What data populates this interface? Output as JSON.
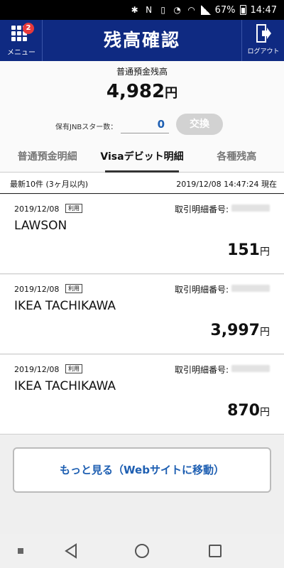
{
  "statusbar": {
    "battery": "67%",
    "time": "14:47"
  },
  "header": {
    "title": "残高確認",
    "menu_label": "メニュー",
    "menu_badge": "2",
    "logout_label": "ログアウト"
  },
  "balance": {
    "label": "普通預金残高",
    "amount": "4,982",
    "unit": "円",
    "stars_label": "保有JNBスター数：",
    "stars_value": "0",
    "exchange_label": "交換"
  },
  "tabs": [
    {
      "label": "普通預金明細"
    },
    {
      "label": "Visaデビット明細"
    },
    {
      "label": "各種残高"
    }
  ],
  "list_header": {
    "left": "最新10件 (3ヶ月以内)",
    "right": "2019/12/08 14:47:24 現在"
  },
  "transactions": [
    {
      "date": "2019/12/08",
      "tag": "利用",
      "id_label": "取引明細番号:",
      "merchant": "LAWSON",
      "amount": "151",
      "unit": "円"
    },
    {
      "date": "2019/12/08",
      "tag": "利用",
      "id_label": "取引明細番号:",
      "merchant": "IKEA TACHIKAWA",
      "amount": "3,997",
      "unit": "円"
    },
    {
      "date": "2019/12/08",
      "tag": "利用",
      "id_label": "取引明細番号:",
      "merchant": "IKEA TACHIKAWA",
      "amount": "870",
      "unit": "円"
    }
  ],
  "more_button": "もっと見る（Webサイトに移動）",
  "colors": {
    "header_bg": "#0f2a82",
    "accent": "#1e5fb2",
    "badge": "#e8393b"
  }
}
